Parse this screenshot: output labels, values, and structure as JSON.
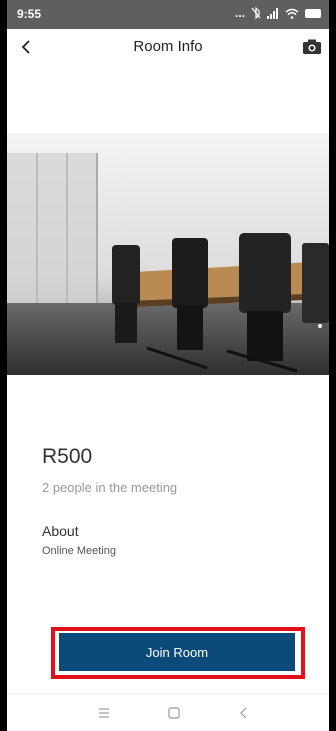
{
  "status_bar": {
    "time": "9:55",
    "dots": "...",
    "icons": [
      "mute-icon",
      "signal-icon",
      "wifi-icon",
      "battery-icon"
    ]
  },
  "header": {
    "title": "Room Info",
    "back_icon": "chevron-left-icon",
    "camera_icon": "camera-icon"
  },
  "room": {
    "name": "R500",
    "people": "2 people in the meeting",
    "about_label": "About",
    "about_value": "Online Meeting"
  },
  "join_button": {
    "label": "Join Room",
    "color": "#0c4a79",
    "highlight_color": "#e3101a"
  },
  "nav_bar": {
    "icons": [
      "menu-icon",
      "home-icon",
      "back-icon"
    ]
  }
}
